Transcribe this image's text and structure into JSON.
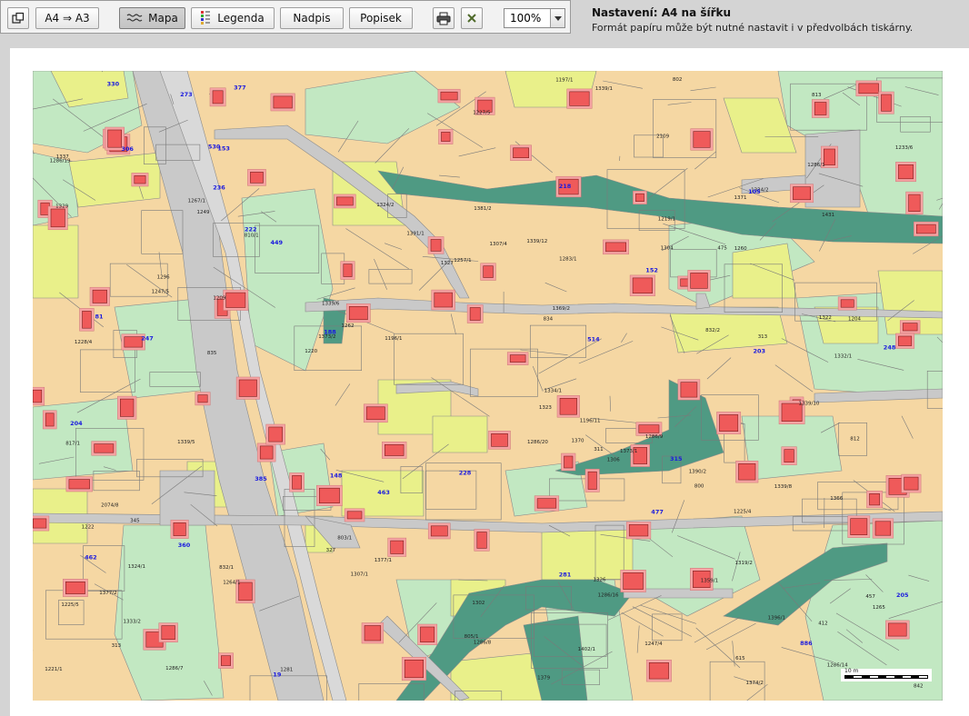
{
  "toolbar": {
    "paper_size_label": "A4 ⇒ A3",
    "map_label": "Mapa",
    "legend_label": "Legenda",
    "caption_label": "Nadpis",
    "description_label": "Popisek",
    "zoom_value": "100%"
  },
  "settings": {
    "title": "Nastavení: A4 na šířku",
    "note": "Formát papíru může být nutné nastavit i v předvolbách tiskárny."
  },
  "map": {
    "parcel_labels": [
      "1402/1",
      "1396/1",
      "1391/1",
      "1381/2",
      "1390/2",
      "1377/1",
      "1379",
      "1377/2",
      "1373/1",
      "1373/2",
      "1374/2",
      "1370",
      "1371",
      "1369/2",
      "1366",
      "1431",
      "1359/1",
      "2074/8",
      "1339/8",
      "1337",
      "1286/20",
      "1286/19",
      "1339/10",
      "1339/5",
      "1339/1",
      "1339/12",
      "1339/6",
      "1334/1",
      "1334/2",
      "1332/1",
      "1286/8",
      "1286/16",
      "1286/7",
      "1324/1",
      "1324/2",
      "1323",
      "2109",
      "1322",
      "1319/2",
      "1286/9",
      "1286/1",
      "1302",
      "1304",
      "1307/1",
      "1307/4",
      "1306",
      "1283/1",
      "1286/14",
      "1264/1",
      "1265",
      "1249",
      "1247/5",
      "1247/4",
      "1225/5",
      "1227/5",
      "1228/4",
      "1197/1",
      "1196/1",
      "1220",
      "1219/1",
      "1221/1",
      "1225/4",
      "1204",
      "1209",
      "1222",
      "842",
      "835",
      "834",
      "832/1",
      "832/2",
      "817/1",
      "810/1",
      "812",
      "813",
      "800",
      "802",
      "803/1",
      "805/1",
      "1296",
      "1329",
      "1326",
      "1333/2",
      "1327",
      "1257/1",
      "1260",
      "1262",
      "1267/1",
      "1281",
      "1233/6",
      "1196/11"
    ],
    "building_labels": [
      "311",
      "313",
      "475",
      "615",
      "345",
      "313",
      "327",
      "457",
      "412"
    ],
    "house_numbers": [
      "188",
      "247",
      "330",
      "205",
      "886",
      "148",
      "281",
      "153",
      "166",
      "105",
      "248",
      "228",
      "19",
      "377",
      "81",
      "152",
      "477",
      "462",
      "236",
      "203",
      "273",
      "222",
      "463",
      "315",
      "449",
      "385",
      "306",
      "204",
      "218",
      "514",
      "530",
      "360"
    ]
  },
  "scale": {
    "label": "10 m"
  },
  "colors": {
    "parcel_tan": "#f5d7a3",
    "parcel_green": "#c2e8c2",
    "parcel_yellow": "#e9f08a",
    "building_red": "#ef5a5a",
    "building_pink": "#f6a3a3",
    "road_grey": "#c9c9c9",
    "water_teal": "#4f9a83",
    "text_blue": "#1a1adf"
  }
}
